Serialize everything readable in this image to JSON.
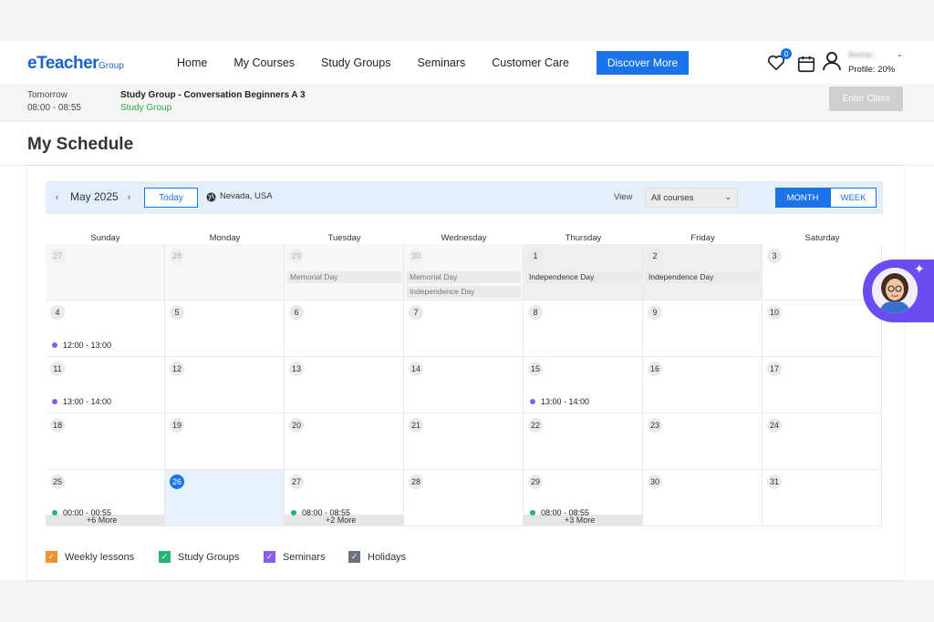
{
  "header": {
    "logo_main": "eTeacher",
    "logo_sub": "Group",
    "nav": [
      "Home",
      "My Courses",
      "Study Groups",
      "Seminars",
      "Customer Care"
    ],
    "discover_label": "Discover More",
    "favorites_count": "0",
    "user_name": "Barbar...",
    "profile": "Profile: 20%",
    "heart_icon": "heart-icon",
    "calendar_icon": "calendar-icon",
    "user_icon": "user-icon"
  },
  "upcoming": {
    "when": "Tomorrow",
    "time": "08:00 - 08:55",
    "title": "Study Group - Conversation Beginners A 3",
    "type": "Study Group",
    "enter_label": "Enter Class"
  },
  "page_title": "My Schedule",
  "toolbar": {
    "month": "May 2025",
    "today_label": "Today",
    "location": "Nevada, USA",
    "view_label": "View",
    "view_value": "All courses",
    "month_btn": "MONTH",
    "week_btn": "WEEK"
  },
  "weekdays": [
    "Sunday",
    "Monday",
    "Tuesday",
    "Wednesday",
    "Thursday",
    "Friday",
    "Saturday"
  ],
  "weeks": [
    [
      {
        "day": "27",
        "other": true
      },
      {
        "day": "28",
        "other": true
      },
      {
        "day": "29",
        "other": true,
        "holidays": [
          "Memorial Day"
        ]
      },
      {
        "day": "30",
        "other": true,
        "holidays": [
          "Memorial Day",
          "Independence Day"
        ]
      },
      {
        "day": "1",
        "shade": true,
        "holidays": [
          "Independence Day"
        ]
      },
      {
        "day": "2",
        "shade": true,
        "holidays": [
          "Independence Day"
        ]
      },
      {
        "day": "3"
      }
    ],
    [
      {
        "day": "4",
        "event": {
          "time": "12:00 - 13:00",
          "color": "#8b5cf6"
        }
      },
      {
        "day": "5"
      },
      {
        "day": "6"
      },
      {
        "day": "7"
      },
      {
        "day": "8"
      },
      {
        "day": "9"
      },
      {
        "day": "10"
      }
    ],
    [
      {
        "day": "11",
        "event": {
          "time": "13:00 - 14:00",
          "color": "#8b5cf6"
        }
      },
      {
        "day": "12"
      },
      {
        "day": "13"
      },
      {
        "day": "14"
      },
      {
        "day": "15",
        "event": {
          "time": "13:00 - 14:00",
          "color": "#8b5cf6"
        }
      },
      {
        "day": "16"
      },
      {
        "day": "17"
      }
    ],
    [
      {
        "day": "18"
      },
      {
        "day": "19"
      },
      {
        "day": "20"
      },
      {
        "day": "21"
      },
      {
        "day": "22"
      },
      {
        "day": "23"
      },
      {
        "day": "24"
      }
    ],
    [
      {
        "day": "25",
        "event": {
          "time": "00:00 - 00:55",
          "color": "#22b573"
        },
        "more": "+6 More"
      },
      {
        "day": "26",
        "today": true
      },
      {
        "day": "27",
        "event": {
          "time": "08:00 - 08:55",
          "color": "#22b573"
        },
        "more": "+2 More"
      },
      {
        "day": "28"
      },
      {
        "day": "29",
        "event": {
          "time": "08:00 - 08:55",
          "color": "#22b573"
        },
        "more": "+3 More"
      },
      {
        "day": "30"
      },
      {
        "day": "31"
      }
    ]
  ],
  "legend": [
    {
      "label": "Weekly lessons",
      "color": "#f0932b"
    },
    {
      "label": "Study Groups",
      "color": "#22b573"
    },
    {
      "label": "Seminars",
      "color": "#8b5cf6"
    },
    {
      "label": "Holidays",
      "color": "#6b7280"
    }
  ],
  "colors": {
    "accent": "#1a73e8",
    "assistant": "#6a4cf0"
  }
}
